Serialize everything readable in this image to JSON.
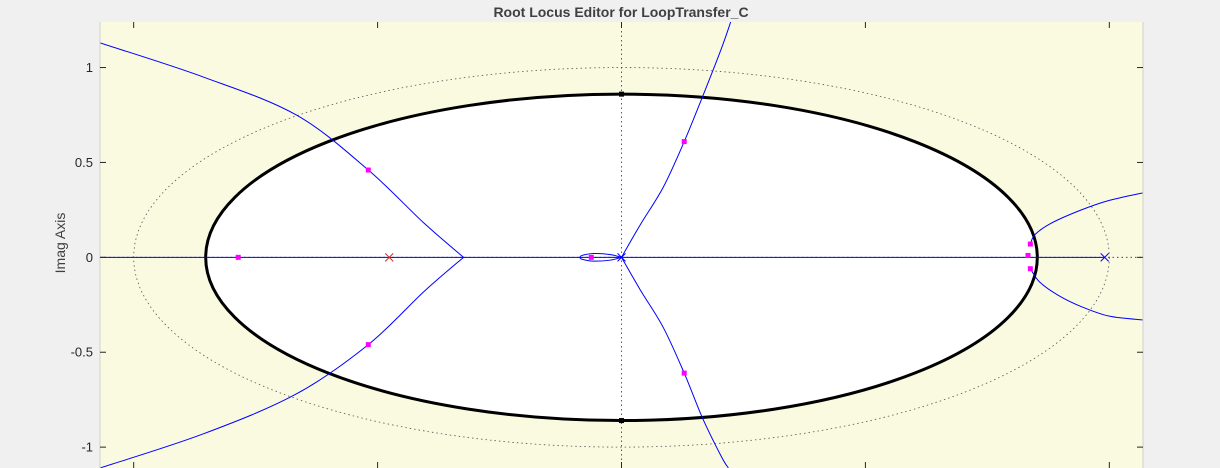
{
  "window": {
    "title": "Root Locus Editor for LoopTransfer_C"
  },
  "chart_data": {
    "type": "scatter",
    "title": "Root Locus Editor for LoopTransfer_C",
    "xlabel": "",
    "ylabel": "Imag Axis",
    "xlim": [
      -2.245,
      2.245
    ],
    "ylim": [
      -1.11,
      1.24
    ],
    "yticks": [
      1,
      0.5,
      0,
      -0.5,
      -1
    ],
    "ytick_labels": [
      "1",
      "0.5",
      "0",
      "-0.5",
      "-1"
    ],
    "xtick_values": [
      -2.1,
      -1.05,
      0,
      1.05,
      2.1
    ],
    "grid": "dotted axes through origin",
    "background_color": "#fafae1",
    "plot_region_color": "#ffffff",
    "locus_color": "#0000ff",
    "marker_color": "#ff00ff",
    "pole_color": "#c03030",
    "design_constraint": {
      "type": "ellipse",
      "center": [
        0,
        0
      ],
      "semi_axis_x": 1.79,
      "semi_axis_y": 0.86
    },
    "constraint_dotted": {
      "type": "ellipse",
      "center": [
        0,
        0
      ],
      "semi_axis_x": 2.1,
      "semi_axis_y": 1.0
    },
    "open_loop_poles": [
      {
        "x": -1.0,
        "y": 0
      },
      {
        "x": 0.0,
        "y": 0
      },
      {
        "x": 2.08,
        "y": 0
      }
    ],
    "closed_loop_poles": [
      {
        "x": -1.65,
        "y": 0
      },
      {
        "x": -1.09,
        "y": 0.46
      },
      {
        "x": -1.09,
        "y": -0.46
      },
      {
        "x": -0.13,
        "y": 0
      },
      {
        "x": 0.27,
        "y": 0.61
      },
      {
        "x": 0.27,
        "y": -0.61
      },
      {
        "x": 1.76,
        "y": 0.07
      },
      {
        "x": 1.76,
        "y": -0.06
      },
      {
        "x": 1.75,
        "y": 0.01
      }
    ],
    "real_axis_locus_segments": [
      [
        -2.245,
        -0.01
      ],
      [
        0.0,
        2.08
      ]
    ],
    "locus_branches": [
      {
        "name": "upper-left",
        "points": [
          [
            -2.245,
            1.13
          ],
          [
            -1.8,
            0.95
          ],
          [
            -1.4,
            0.75
          ],
          [
            -1.09,
            0.46
          ],
          [
            -0.85,
            0.18
          ],
          [
            -0.68,
            0.0
          ]
        ]
      },
      {
        "name": "lower-left",
        "points": [
          [
            -0.68,
            0.0
          ],
          [
            -0.85,
            -0.18
          ],
          [
            -1.09,
            -0.46
          ],
          [
            -1.4,
            -0.72
          ],
          [
            -1.8,
            -0.93
          ],
          [
            -2.245,
            -1.11
          ]
        ]
      },
      {
        "name": "upper-center",
        "points": [
          [
            0.0,
            0.0
          ],
          [
            0.08,
            0.17
          ],
          [
            0.18,
            0.37
          ],
          [
            0.27,
            0.61
          ],
          [
            0.35,
            0.85
          ],
          [
            0.43,
            1.1
          ],
          [
            0.47,
            1.24
          ]
        ]
      },
      {
        "name": "lower-center",
        "points": [
          [
            0.0,
            0.0
          ],
          [
            0.08,
            -0.17
          ],
          [
            0.18,
            -0.37
          ],
          [
            0.27,
            -0.61
          ],
          [
            0.35,
            -0.85
          ],
          [
            0.43,
            -1.05
          ],
          [
            0.46,
            -1.11
          ]
        ]
      },
      {
        "name": "upper-right",
        "points": [
          [
            1.76,
            0.07
          ],
          [
            1.78,
            0.12
          ],
          [
            1.85,
            0.18
          ],
          [
            1.98,
            0.25
          ],
          [
            2.1,
            0.3
          ],
          [
            2.245,
            0.34
          ]
        ]
      },
      {
        "name": "lower-right",
        "points": [
          [
            1.76,
            -0.06
          ],
          [
            1.8,
            -0.13
          ],
          [
            1.88,
            -0.2
          ],
          [
            1.98,
            -0.26
          ],
          [
            2.1,
            -0.31
          ],
          [
            2.245,
            -0.33
          ]
        ]
      },
      {
        "name": "origin-loop-upper",
        "points": [
          [
            0.0,
            0.0
          ],
          [
            -0.05,
            0.015
          ],
          [
            -0.12,
            0.02
          ],
          [
            -0.17,
            0.01
          ],
          [
            -0.18,
            0.0
          ]
        ]
      },
      {
        "name": "origin-loop-lower",
        "points": [
          [
            -0.18,
            0.0
          ],
          [
            -0.17,
            -0.01
          ],
          [
            -0.12,
            -0.02
          ],
          [
            -0.05,
            -0.015
          ],
          [
            0.0,
            0.0
          ]
        ]
      }
    ]
  }
}
